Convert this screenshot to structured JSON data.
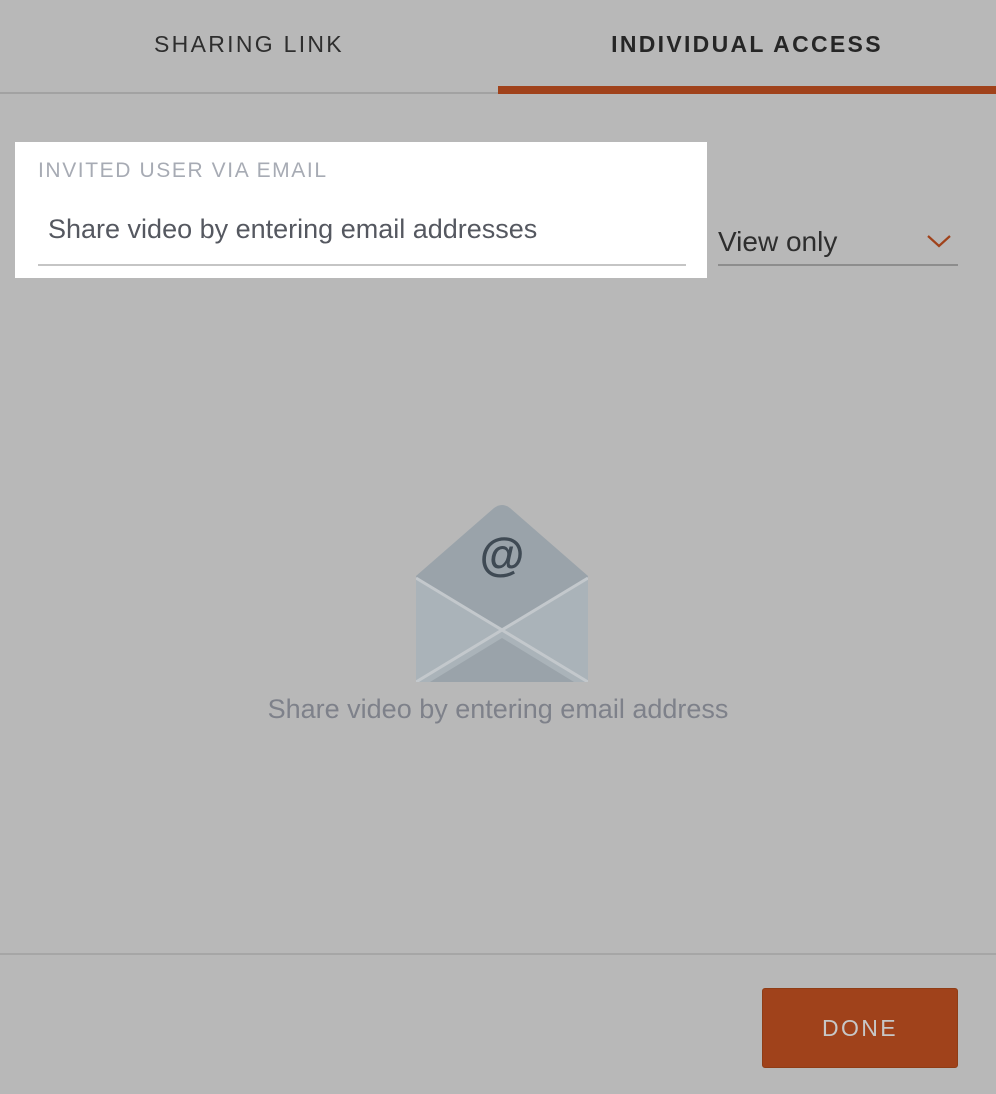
{
  "colors": {
    "accent": "#a0421b",
    "backdrop": "#b8b8b8",
    "card": "#ffffff",
    "envelope_back": "#9aa3aa",
    "envelope_front": "#aab3b9",
    "at_symbol": "#3f4a54"
  },
  "tabs": [
    {
      "label": "SHARING LINK",
      "active": false
    },
    {
      "label": "INDIVIDUAL ACCESS",
      "active": true
    }
  ],
  "invite": {
    "field_label": "INVITED USER VIA EMAIL",
    "placeholder": "Share video by entering email addresses",
    "value": ""
  },
  "permission": {
    "selected": "View only",
    "icon": "chevron-down-icon"
  },
  "empty_state": {
    "icon": "envelope-at-icon",
    "at_glyph": "@",
    "message": "Share video by entering email address"
  },
  "footer": {
    "done_label": "DONE"
  }
}
